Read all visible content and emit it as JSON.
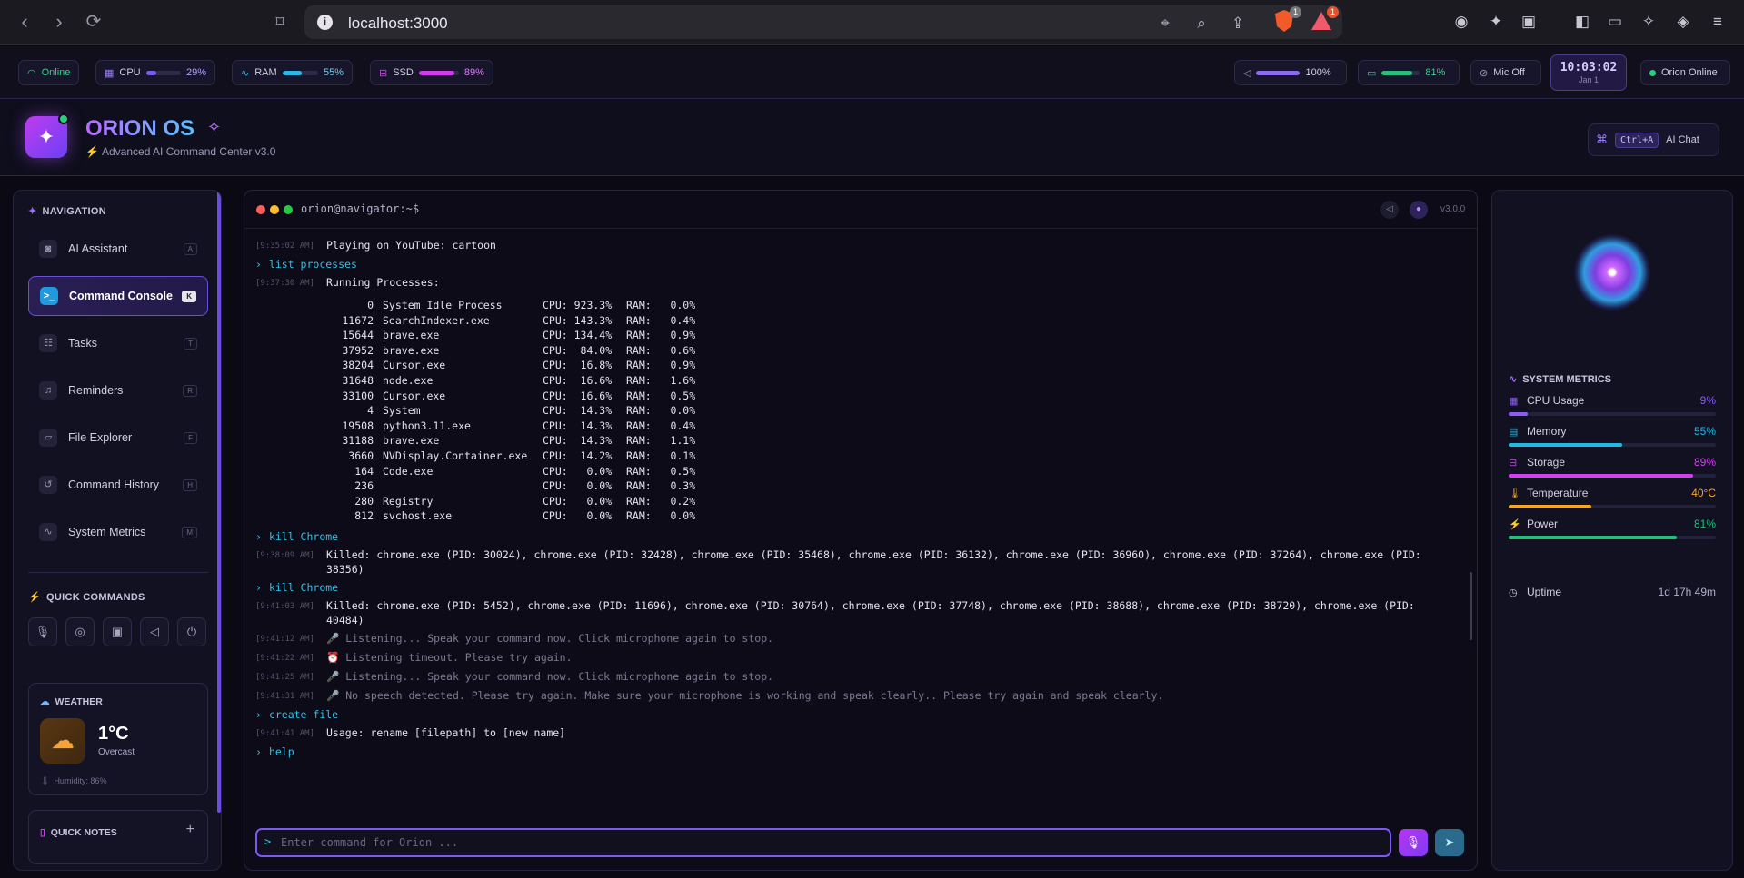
{
  "browser": {
    "url": "localhost:3000",
    "brave_badge": "1",
    "rewards_badge": "1"
  },
  "status": {
    "online": "Online",
    "cpu": {
      "label": "CPU",
      "value": "29%",
      "level": 0.29,
      "color": "#7b5cf0"
    },
    "ram": {
      "label": "RAM",
      "value": "55%",
      "level": 0.55,
      "color": "#2fb6e8"
    },
    "ssd": {
      "label": "SSD",
      "value": "89%",
      "level": 0.89,
      "color": "#d23bf0"
    },
    "volume": {
      "value": "100%",
      "level": 1.0,
      "color": "#8c6bf0"
    },
    "battery": {
      "value": "81%",
      "level": 0.81,
      "color": "#26c07c"
    },
    "mic": "Mic Off",
    "time": "10:03:02",
    "date": "Jan 1",
    "orion_status": "Orion Online"
  },
  "header": {
    "title": "ORION OS",
    "subtitle": "Advanced AI Command Center v3.0",
    "shortcut": "Ctrl+A",
    "ai_chat": "AI Chat"
  },
  "sidebar": {
    "nav_title": "NAVIGATION",
    "items": [
      {
        "label": "AI Assistant",
        "key": "A",
        "icon": "robot-icon"
      },
      {
        "label": "Command Console",
        "key": "K",
        "icon": "terminal-icon"
      },
      {
        "label": "Tasks",
        "key": "T",
        "icon": "checklist-icon"
      },
      {
        "label": "Reminders",
        "key": "R",
        "icon": "bell-icon"
      },
      {
        "label": "File Explorer",
        "key": "F",
        "icon": "folder-icon"
      },
      {
        "label": "Command History",
        "key": "H",
        "icon": "history-icon"
      },
      {
        "label": "System Metrics",
        "key": "M",
        "icon": "activity-icon"
      }
    ],
    "quick_title": "QUICK COMMANDS",
    "weather": {
      "title": "WEATHER",
      "temp": "1°C",
      "condition": "Overcast",
      "humidity": "Humidity: 86%"
    },
    "notes_title": "QUICK NOTES"
  },
  "console": {
    "title": "orion@navigator:~$",
    "version": "v3.0.0",
    "placeholder": "Enter command for Orion ...",
    "entries": [
      {
        "type": "out",
        "ts": "[9:35:02 AM]",
        "text": "Playing on YouTube: cartoon"
      },
      {
        "type": "cmd",
        "text": "list processes"
      },
      {
        "type": "out",
        "ts": "[9:37:30 AM]",
        "text": "Running Processes:"
      }
    ],
    "processes": [
      {
        "pid": "0",
        "name": "System Idle Process",
        "cpu": "CPU: 923.3%",
        "ram": "RAM:   0.0%"
      },
      {
        "pid": "11672",
        "name": "SearchIndexer.exe",
        "cpu": "CPU: 143.3%",
        "ram": "RAM:   0.4%"
      },
      {
        "pid": "15644",
        "name": "brave.exe",
        "cpu": "CPU: 134.4%",
        "ram": "RAM:   0.9%"
      },
      {
        "pid": "37952",
        "name": "brave.exe",
        "cpu": "CPU:  84.0%",
        "ram": "RAM:   0.6%"
      },
      {
        "pid": "38204",
        "name": "Cursor.exe",
        "cpu": "CPU:  16.8%",
        "ram": "RAM:   0.9%"
      },
      {
        "pid": "31648",
        "name": "node.exe",
        "cpu": "CPU:  16.6%",
        "ram": "RAM:   1.6%"
      },
      {
        "pid": "33100",
        "name": "Cursor.exe",
        "cpu": "CPU:  16.6%",
        "ram": "RAM:   0.5%"
      },
      {
        "pid": "4",
        "name": "System",
        "cpu": "CPU:  14.3%",
        "ram": "RAM:   0.0%"
      },
      {
        "pid": "19508",
        "name": "python3.11.exe",
        "cpu": "CPU:  14.3%",
        "ram": "RAM:   0.4%"
      },
      {
        "pid": "31188",
        "name": "brave.exe",
        "cpu": "CPU:  14.3%",
        "ram": "RAM:   1.1%"
      },
      {
        "pid": "3660",
        "name": "NVDisplay.Container.exe",
        "cpu": "CPU:  14.2%",
        "ram": "RAM:   0.1%"
      },
      {
        "pid": "164",
        "name": "Code.exe",
        "cpu": "CPU:   0.0%",
        "ram": "RAM:   0.5%"
      },
      {
        "pid": "236",
        "name": "",
        "cpu": "CPU:   0.0%",
        "ram": "RAM:   0.3%"
      },
      {
        "pid": "280",
        "name": "Registry",
        "cpu": "CPU:   0.0%",
        "ram": "RAM:   0.2%"
      },
      {
        "pid": "812",
        "name": "svchost.exe",
        "cpu": "CPU:   0.0%",
        "ram": "RAM:   0.0%"
      }
    ],
    "entries2": [
      {
        "type": "cmd",
        "text": "kill Chrome"
      },
      {
        "type": "out",
        "ts": "[9:38:09 AM]",
        "text": "Killed: chrome.exe (PID: 30024), chrome.exe (PID: 32428), chrome.exe (PID: 35468), chrome.exe (PID: 36132), chrome.exe (PID: 36960), chrome.exe (PID: 37264), chrome.exe (PID: 38356)"
      },
      {
        "type": "cmd",
        "text": "kill Chrome"
      },
      {
        "type": "out",
        "ts": "[9:41:03 AM]",
        "text": "Killed: chrome.exe (PID: 5452), chrome.exe (PID: 11696), chrome.exe (PID: 30764), chrome.exe (PID: 37748), chrome.exe (PID: 38688), chrome.exe (PID: 38720), chrome.exe (PID: 40484)"
      },
      {
        "type": "muted",
        "ts": "[9:41:12 AM]",
        "text": "🎤 Listening... Speak your command now. Click microphone again to stop."
      },
      {
        "type": "muted",
        "ts": "[9:41:22 AM]",
        "text": "⏰ Listening timeout. Please try again."
      },
      {
        "type": "muted",
        "ts": "[9:41:25 AM]",
        "text": "🎤 Listening... Speak your command now. Click microphone again to stop."
      },
      {
        "type": "muted",
        "ts": "[9:41:31 AM]",
        "text": "🎤 No speech detected. Please try again. Make sure your microphone is working and speak clearly.. Please try again and speak clearly."
      },
      {
        "type": "cmd",
        "text": "create file"
      },
      {
        "type": "out",
        "ts": "[9:41:41 AM]",
        "text": "Usage: rename [filepath] to [new name]"
      },
      {
        "type": "cmd",
        "text": "help"
      }
    ]
  },
  "metrics": {
    "title": "SYSTEM METRICS",
    "items": [
      {
        "label": "CPU Usage",
        "value": "9%",
        "level": 0.09,
        "color": "#8b5cf6",
        "icon": "cpu-icon"
      },
      {
        "label": "Memory",
        "value": "55%",
        "level": 0.55,
        "color": "#22b8e6",
        "icon": "memory-icon"
      },
      {
        "label": "Storage",
        "value": "89%",
        "level": 0.89,
        "color": "#d33ff0",
        "icon": "storage-icon"
      },
      {
        "label": "Temperature",
        "value": "40°C",
        "level": 0.4,
        "color": "#f5a623",
        "icon": "thermometer-icon"
      },
      {
        "label": "Power",
        "value": "81%",
        "level": 0.81,
        "color": "#22c07a",
        "icon": "power-icon"
      }
    ],
    "uptime_label": "Uptime",
    "uptime_value": "1d 17h 49m"
  }
}
